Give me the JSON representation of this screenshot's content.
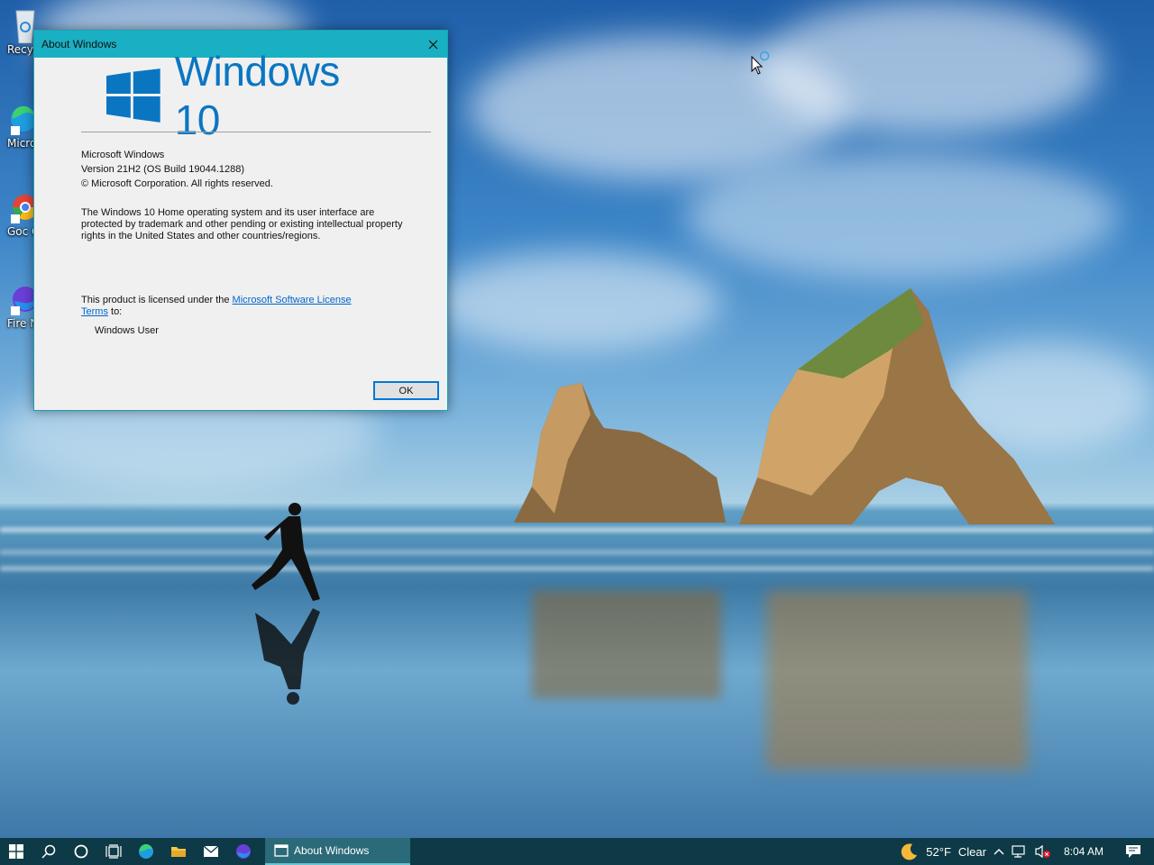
{
  "desktop": {
    "icons": [
      {
        "label": "Recyc",
        "icon": "recycle-bin-icon"
      },
      {
        "label": "Micro Ed",
        "icon": "edge-icon"
      },
      {
        "label": "Goc Chro",
        "icon": "chrome-icon"
      },
      {
        "label": "Fire Nig",
        "icon": "firefox-icon"
      }
    ]
  },
  "dialog": {
    "title": "About Windows",
    "logo_text": "Windows 10",
    "product": "Microsoft Windows",
    "version": "Version 21H2 (OS Build 19044.1288)",
    "copyright": "© Microsoft Corporation. All rights reserved.",
    "legal": "The Windows 10 Home operating system and its user interface are protected by trademark and other pending or existing intellectual property rights in the United States and other countries/regions.",
    "license_prefix": "This product is licensed under the ",
    "license_link": "Microsoft Software License Terms",
    "license_suffix": " to:",
    "user": "Windows User",
    "ok_label": "OK"
  },
  "taskbar": {
    "active_app": "About Windows",
    "weather_temp": "52°F",
    "weather_desc": "Clear",
    "time": "8:04 AM"
  },
  "colors": {
    "accent": "#1ab0c3",
    "windows_blue": "#0a76c2",
    "taskbar": "#0d3a46"
  }
}
